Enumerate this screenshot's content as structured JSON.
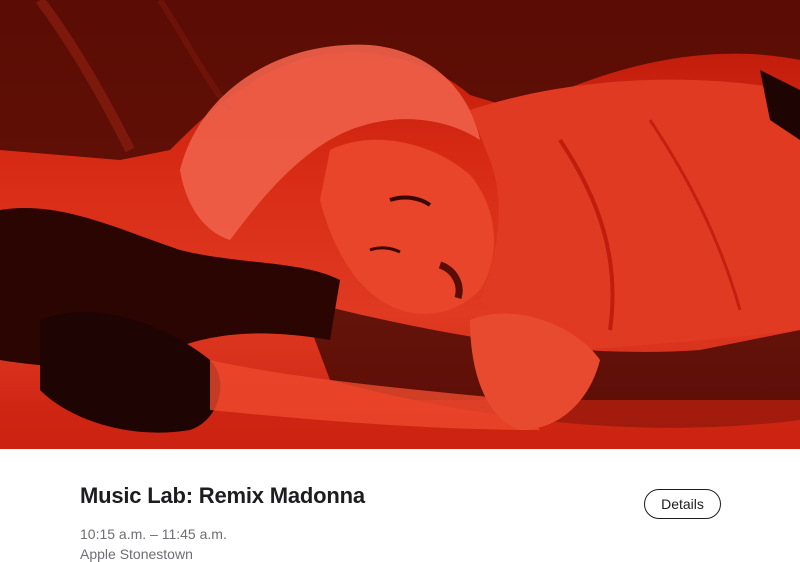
{
  "event": {
    "title": "Music Lab: Remix Madonna",
    "time": "10:15 a.m. – 11:45 a.m.",
    "location": "Apple Stonestown",
    "details_label": "Details"
  },
  "colors": {
    "hero_tint": "#d72a14",
    "hero_shadow": "#2a0502",
    "title_text": "#1d1d1f",
    "secondary_text": "#6e6e73",
    "button_border": "#1d1d1f"
  }
}
